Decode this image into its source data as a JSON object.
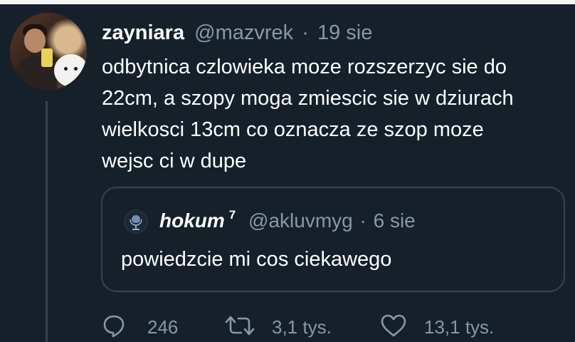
{
  "tweet": {
    "display_name": "zayniara",
    "handle": "@mazvrek",
    "separator": "·",
    "date": "19 sie",
    "text_lines": [
      "odbytnica czlowieka moze rozszerzyc sie do",
      "22cm, a szopy moga zmiescic sie w dziurach",
      "wielkosci 13cm co oznacza ze szop moze",
      "wejsc ci w dupe"
    ]
  },
  "quoted_tweet": {
    "display_name": "hokum",
    "superscript": "7",
    "handle": "@akluvmyg",
    "separator": "·",
    "date": "6 sie",
    "text": "powiedzcie mi cos ciekawego"
  },
  "actions": {
    "reply_count": "246",
    "retweet_count": "3,1 tys.",
    "like_count": "13,1 tys."
  },
  "colors": {
    "background": "#15202b",
    "muted_text": "#8899a6",
    "border": "#38444d",
    "primary_text": "#ffffff"
  }
}
